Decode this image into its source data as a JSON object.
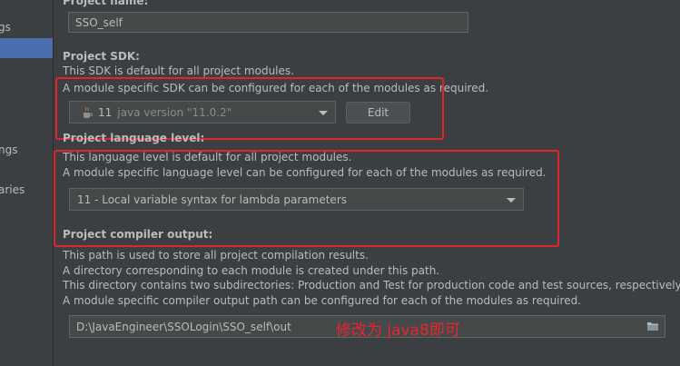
{
  "sidebar": {
    "items": [
      {
        "label": "gs"
      },
      {
        "label": "ngs"
      },
      {
        "label": "aries"
      }
    ]
  },
  "project_name": {
    "heading": "Project name:",
    "value": "SSO_self"
  },
  "sdk": {
    "heading": "Project SDK:",
    "desc1": "This SDK is default for all project modules.",
    "desc2": "A module specific SDK can be configured for each of the modules as required.",
    "selected_version": "11",
    "selected_detail": "java version \"11.0.2\"",
    "edit_label": "Edit"
  },
  "language_level": {
    "heading": "Project language level:",
    "desc1": "This language level is default for all project modules.",
    "desc2": "A module specific language level can be configured for each of the modules as required.",
    "selected": "11 - Local variable syntax for lambda parameters"
  },
  "compiler_output": {
    "heading": "Project compiler output:",
    "desc1": "This path is used to store all project compilation results.",
    "desc2": "A directory corresponding to each module is created under this path.",
    "desc3": "This directory contains two subdirectories: Production and Test for production code and test sources, respectively.",
    "desc4": "A module specific compiler output path can be configured for each of the modules as required.",
    "path": "D:\\JavaEngineer\\SSOLogin\\SSO_self\\out"
  },
  "annotation": "修改为 java8即可",
  "colors": {
    "background": "#3c3f41",
    "highlight_box": "#e0262d",
    "selection": "#4b6eaf"
  }
}
